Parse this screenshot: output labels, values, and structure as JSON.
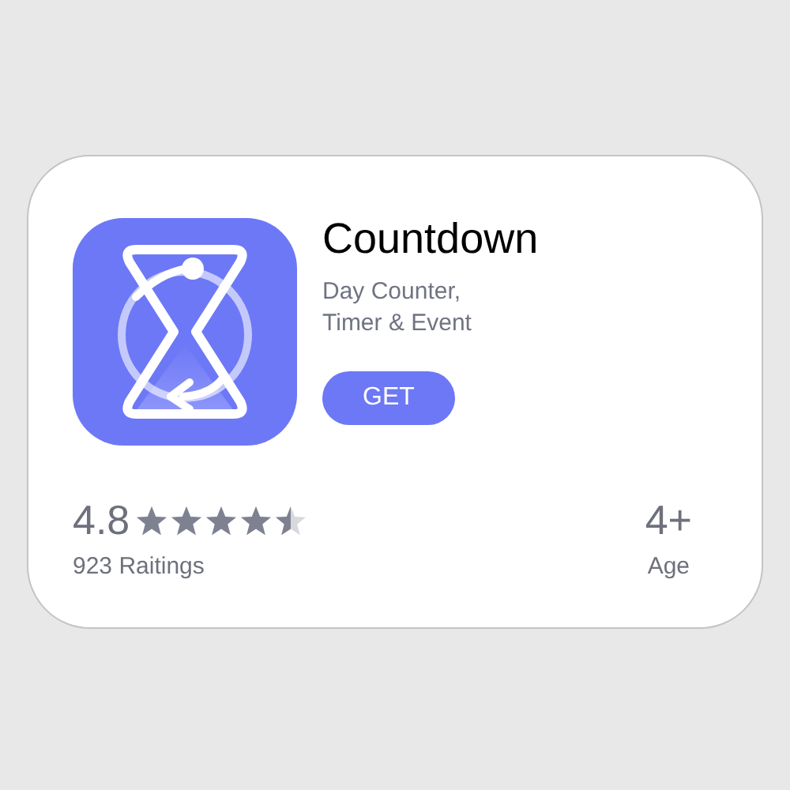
{
  "app": {
    "name": "Countdown",
    "subtitle_lines": [
      "Day Counter,",
      "Timer & Event"
    ],
    "button": "GET"
  },
  "rating": {
    "score": "4.8",
    "stars": 4.5,
    "count": "923 Raitings"
  },
  "age": {
    "value": "4+",
    "label": "Age"
  }
}
